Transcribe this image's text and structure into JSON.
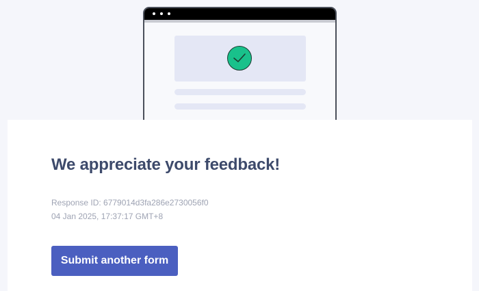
{
  "illustration": {
    "icon": "check-icon",
    "check_color": "#19c18b"
  },
  "confirmation": {
    "title": "We appreciate your feedback!",
    "response_id": "Response ID: 6779014d3fa286e2730056f0",
    "timestamp": "04 Jan 2025, 17:37:17 GMT+8"
  },
  "actions": {
    "submit_another_label": "Submit another form",
    "accent_color": "#4b5fc0"
  }
}
